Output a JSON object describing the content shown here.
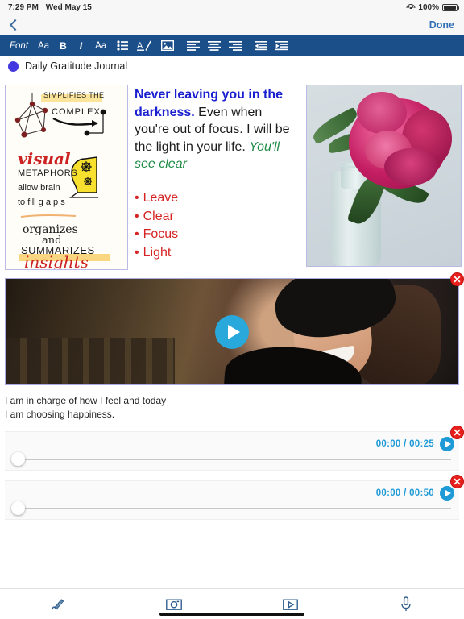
{
  "status_bar": {
    "time": "7:29 PM",
    "date": "Wed May 15",
    "battery_percent": "100%",
    "wifi_icon": "wifi-icon",
    "battery_icon": "battery-icon"
  },
  "nav_bar": {
    "back_icon": "chevron-left-icon",
    "done_label": "Done"
  },
  "format_toolbar": {
    "items": [
      {
        "label": "Font",
        "name": "font-button",
        "icon": "text-label"
      },
      {
        "label": "Aa",
        "name": "font-size-button",
        "icon": "text-label"
      },
      {
        "label": "B",
        "name": "bold-button",
        "icon": "bold-icon"
      },
      {
        "label": "I",
        "name": "italic-button",
        "icon": "italic-icon"
      },
      {
        "label": "Aa",
        "name": "text-style-button",
        "icon": "text-label"
      },
      {
        "label": "",
        "name": "bullet-list-button",
        "icon": "bullet-list-icon"
      },
      {
        "label": "A/",
        "name": "text-color-button",
        "icon": "text-color-icon"
      },
      {
        "label": "",
        "name": "insert-image-button",
        "icon": "image-icon"
      },
      {
        "label": "",
        "name": "align-left-button",
        "icon": "align-left-icon"
      },
      {
        "label": "",
        "name": "align-center-button",
        "icon": "align-center-icon"
      },
      {
        "label": "",
        "name": "align-right-button",
        "icon": "align-right-icon"
      },
      {
        "label": "",
        "name": "outdent-button",
        "icon": "outdent-icon"
      },
      {
        "label": "",
        "name": "indent-button",
        "icon": "indent-icon"
      }
    ]
  },
  "document": {
    "title": "Daily Gratitude Journal",
    "bullet_color": "#4338e0"
  },
  "note": {
    "sketch_image": {
      "alt": "sketchnote-visual-metaphors",
      "lines": [
        "SIMPLIFIES THE",
        "COMPLEX",
        "visual",
        "METAPHORS",
        "allow brain",
        "to fill g a p s",
        "organizes",
        "and",
        "SUMMARIZES",
        "insights"
      ]
    },
    "paragraph": {
      "blue_bold": "Never leaving you in the darkness.",
      "black": " Even when you're out of focus. I will be the light in your life. ",
      "green_italic": "You'll see clear"
    },
    "bullets": [
      "Leave",
      "Clear",
      "Focus",
      "Light"
    ],
    "photo": {
      "alt": "pink-peony-in-glass-vase"
    },
    "colors": {
      "blue": "#1a20cf",
      "green": "#1e8b45",
      "red": "#d62424"
    }
  },
  "video": {
    "alt": "smiling-woman-in-black-hat",
    "play_icon": "play-icon",
    "close_icon": "close-icon"
  },
  "affirmation": {
    "line1": "I am in charge of how I feel and today",
    "line2": "I am choosing happiness."
  },
  "audio_players": [
    {
      "time": "00:00 / 00:25",
      "play_icon": "play-icon",
      "close_icon": "close-icon",
      "progress": 0
    },
    {
      "time": "00:00 / 00:50",
      "play_icon": "play-icon",
      "close_icon": "close-icon",
      "progress": 0
    }
  ],
  "bottom_toolbar": {
    "items": [
      {
        "name": "draw-button",
        "icon": "pen-icon"
      },
      {
        "name": "camera-button",
        "icon": "camera-icon"
      },
      {
        "name": "video-button",
        "icon": "video-icon"
      },
      {
        "name": "microphone-button",
        "icon": "microphone-icon"
      }
    ]
  },
  "accent_colors": {
    "toolbar_blue": "#1b4f8a",
    "play_blue": "#29a8dc",
    "audio_blue": "#1e9ad6",
    "close_red": "#e8201d",
    "done_blue": "#2f6fb5"
  }
}
